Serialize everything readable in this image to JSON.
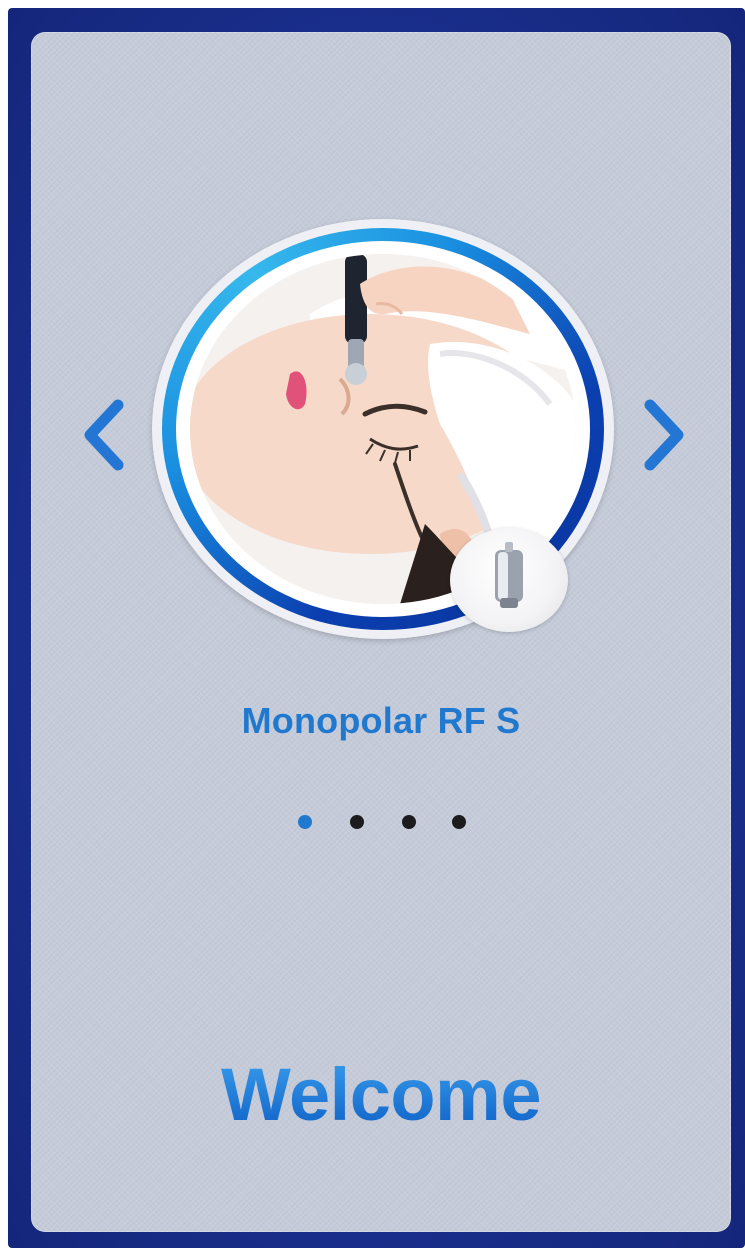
{
  "carousel": {
    "product_name": "Monopolar RF S",
    "photo_icon": "facial-treatment-photo",
    "tip_icon": "rf-probe-tip-icon",
    "prev_icon": "chevron-left-icon",
    "next_icon": "chevron-right-icon",
    "page_count": 4,
    "active_index": 1
  },
  "welcome": {
    "label": "Welcome"
  },
  "colors": {
    "accent": "#2179cf",
    "frame": "#1b3191",
    "panel": "#c5cbd8",
    "dot_inactive": "#1c1c1c"
  }
}
